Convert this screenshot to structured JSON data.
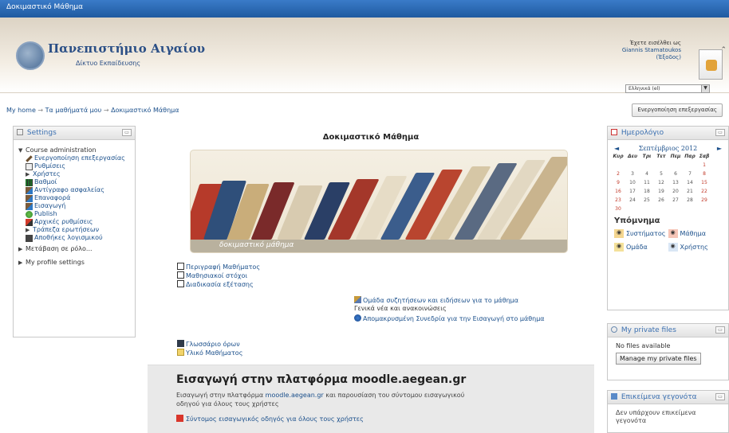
{
  "topbar": {
    "title": "Δοκιμαστικό Μάθημα"
  },
  "header": {
    "site_name": "Πανεπιστήμιο Αιγαίου",
    "site_subtitle": "Δίκτυο Εκπαίδευσης",
    "login_prefix": "Έχετε εισέλθει ως",
    "user_name": "Giannis Stamatoukos",
    "logout_label": "(Έξοδος)",
    "language": "Ελληνικά (el)"
  },
  "breadcrumb": {
    "items": [
      "My home",
      "Τα μαθήματά μου",
      "Δοκιμαστικό Μάθημα"
    ],
    "separator": "→"
  },
  "edit_button": "Ενεργοποίηση επεξεργασίας",
  "settings": {
    "title": "Settings",
    "course_admin": "Course administration",
    "items": [
      "Ενεργοποίηση επεξεργασίας",
      "Ρυθμίσεις",
      "Χρήστες",
      "Βαθμοί",
      "Αντίγραφο ασφαλείας",
      "Επαναφορά",
      "Εισαγωγή",
      "Publish",
      "Αρχικές ρυθμίσεις",
      "Τράπεζα ερωτήσεων",
      "Αποθήκες λογισμικού"
    ],
    "switch_role": "Μετάβαση σε ρόλο...",
    "profile_settings": "My profile settings"
  },
  "course": {
    "title": "Δοκιμαστικό Μάθημα",
    "banner_caption": "δοκιμαστικό μάθημα",
    "resources_left": [
      "Περιγραφή Μαθήματος",
      "Μαθησιακοί στόχοι",
      "Διαδικασία εξέτασης"
    ],
    "forum_title": "Ομάδα συζητήσεων και ειδήσεων για το μάθημα",
    "forum_desc": "Γενικά νέα και ανακοινώσεις",
    "remote_session": "Απομακρυσμένη Συνεδρία για την Εισαγωγή στο μάθημα",
    "glossary": "Γλωσσάριο όρων",
    "material": "Υλικό Μαθήματος"
  },
  "section": {
    "title": "Εισαγωγή στην πλατφόρμα moodle.aegean.gr",
    "desc_before": "Εισαγωγή στην πλατφόρμα ",
    "desc_link": "moodle.aegean.gr",
    "desc_after": " και παρουσίαση του σύντομου εισαγωγικού οδηγού για όλους τους χρήστες",
    "guide_link": "Σύντομος εισαγωγικός οδηγός για όλους τους χρήστες"
  },
  "calendar": {
    "title": "Ημερολόγιο",
    "month": "Σεπτέμβριος 2012",
    "prev": "◄",
    "next": "►",
    "day_headers": [
      "Κυρ",
      "Δευ",
      "Τρι",
      "Τετ",
      "Πεμ",
      "Παρ",
      "Σαβ"
    ],
    "days": [
      "",
      "",
      "",
      "",
      "",
      "",
      "1",
      "2",
      "3",
      "4",
      "5",
      "6",
      "7",
      "8",
      "9",
      "10",
      "11",
      "12",
      "13",
      "14",
      "15",
      "16",
      "17",
      "18",
      "19",
      "20",
      "21",
      "22",
      "23",
      "24",
      "25",
      "26",
      "27",
      "28",
      "29",
      "30",
      "",
      "",
      "",
      "",
      "",
      ""
    ],
    "legend_title": "Υπόμνημα",
    "legend": [
      "Συστήματος",
      "Μάθημα",
      "Ομάδα",
      "Χρήστης"
    ]
  },
  "private_files": {
    "title": "My private files",
    "empty": "No files available",
    "manage": "Manage my private files"
  },
  "events": {
    "title": "Επικείμενα γεγονότα",
    "empty": "Δεν υπάρχουν επικείμενα γεγονότα"
  },
  "colors": {
    "topbar": "#2a68b0",
    "link": "#1a4f8b",
    "legend_system": "#f4d690",
    "legend_course": "#f6c5b7",
    "legend_group": "#f4e19a",
    "legend_user": "#d9e6f5"
  }
}
